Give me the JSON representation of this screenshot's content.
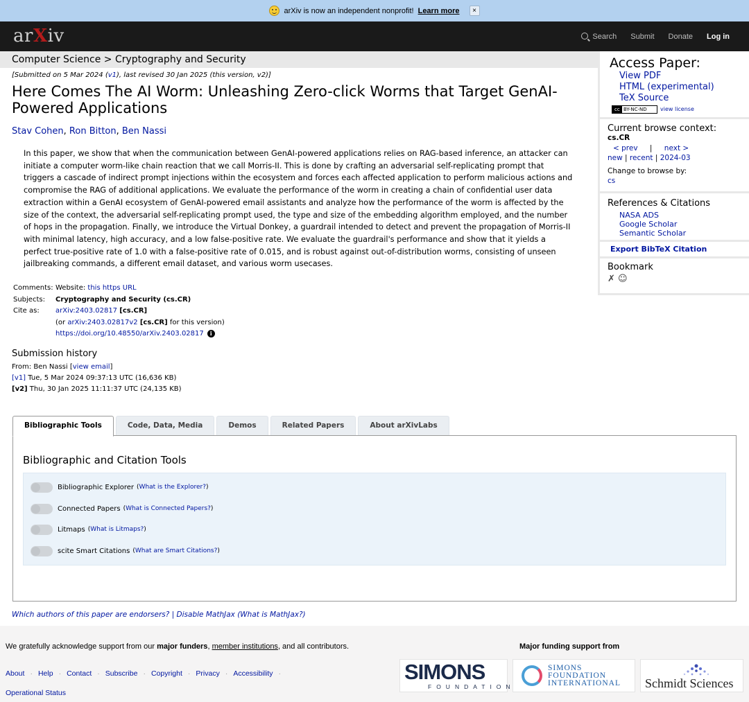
{
  "banner": {
    "message": "arXiv is now an independent nonprofit!",
    "link": "Learn more",
    "close": "×"
  },
  "header": {
    "logo_pre": "ar",
    "logo_x": "X",
    "logo_post": "iv",
    "nav": {
      "search": "Search",
      "submit": "Submit",
      "donate": "Donate",
      "login": "Log in"
    }
  },
  "breadcrumb": "Computer Science > Cryptography and Security",
  "paper": {
    "dateline_pre": "[Submitted on 5 Mar 2024 (",
    "dateline_v1": "v1",
    "dateline_post": "), last revised 30 Jan 2025 (this version, v2)]",
    "title": "Here Comes The AI Worm: Unleashing Zero-click Worms that Target GenAI-Powered Applications",
    "authors": [
      "Stav Cohen",
      "Ron Bitton",
      "Ben Nassi"
    ],
    "abstract": "In this paper, we show that when the communication between GenAI-powered applications relies on RAG-based inference, an attacker can initiate a computer worm-like chain reaction that we call Morris-II. This is done by crafting an adversarial self-replicating prompt that triggers a cascade of indirect prompt injections within the ecosystem and forces each affected application to perform malicious actions and compromise the RAG of additional applications. We evaluate the performance of the worm in creating a chain of confidential user data extraction within a GenAI ecosystem of GenAI-powered email assistants and analyze how the performance of the worm is affected by the size of the context, the adversarial self-replicating prompt used, the type and size of the embedding algorithm employed, and the number of hops in the propagation. Finally, we introduce the Virtual Donkey, a guardrail intended to detect and prevent the propagation of Morris-II with minimal latency, high accuracy, and a low false-positive rate. We evaluate the guardrail's performance and show that it yields a perfect true-positive rate of 1.0 with a false-positive rate of 0.015, and is robust against out-of-distribution worms, consisting of unseen jailbreaking commands, a different email dataset, and various worm usecases."
  },
  "meta": {
    "comments_label": "Comments:",
    "comments_text": "Website: ",
    "comments_link": "this https URL",
    "subjects_label": "Subjects:",
    "subjects_value": "Cryptography and Security (cs.CR)",
    "cite_label": "Cite as:",
    "cite_id": "arXiv:2403.02817",
    "cite_cat": "[cs.CR]",
    "cite_or_pre": "(or ",
    "cite_v2": "arXiv:2403.02817v2",
    "cite_v2_cat": "[cs.CR]",
    "cite_v2_post": " for this version)",
    "doi": "https://doi.org/10.48550/arXiv.2403.02817"
  },
  "history": {
    "heading": "Submission history",
    "from_pre": "From: Ben Nassi [",
    "from_link": "view email",
    "from_post": "]",
    "v1_tag": "[v1]",
    "v1_text": " Tue, 5 Mar 2024 09:37:13 UTC (16,636 KB)",
    "v2_tag": "[v2]",
    "v2_text": " Thu, 30 Jan 2025 11:11:37 UTC (24,135 KB)"
  },
  "sidebar": {
    "access_title": "Access Paper:",
    "access_links": [
      "View PDF",
      "HTML (experimental)",
      "TeX Source"
    ],
    "license_badge": "BY-NC-ND",
    "view_license": "view license",
    "browse_title": "Current browse context:",
    "browse_ctx": "cs.CR",
    "prev": "< prev",
    "sep": "|",
    "next": "next >",
    "new": "new",
    "recent": "recent",
    "month": "2024-03",
    "change_title": "Change to browse by:",
    "change_cs": "cs",
    "refs_title": "References & Citations",
    "refs_links": [
      "NASA ADS",
      "Google Scholar",
      "Semantic Scholar"
    ],
    "export": "Export BibTeX Citation",
    "bookmark_title": "Bookmark"
  },
  "tabs": [
    "Bibliographic Tools",
    "Code, Data, Media",
    "Demos",
    "Related Papers",
    "About arXivLabs"
  ],
  "tools": {
    "heading": "Bibliographic and Citation Tools",
    "items": [
      {
        "label": "Bibliographic Explorer",
        "q": "What is the Explorer?"
      },
      {
        "label": "Connected Papers",
        "q": "What is Connected Papers?"
      },
      {
        "label": "Litmaps",
        "q": "What is Litmaps?"
      },
      {
        "label": "scite Smart Citations",
        "q": "What are Smart Citations?"
      }
    ]
  },
  "endorse": {
    "endorsers": "Which authors of this paper are endorsers?",
    "sep": " | ",
    "mathjax": "Disable MathJax",
    "what": "(What is MathJax?)"
  },
  "footer": {
    "ack_pre": "We gratefully acknowledge support from our ",
    "ack_funders": "major funders",
    "ack_comma": ", ",
    "ack_members": "member institutions",
    "ack_post": ", and all contributors.",
    "links": [
      "About",
      "Help",
      "Contact",
      "Subscribe",
      "Copyright",
      "Privacy",
      "Accessibility",
      "Operational Status"
    ],
    "major_funding": "Major funding support from",
    "simons_big": "SIMONS",
    "simons_small": "FOUNDATION",
    "sfi_text": [
      "SIMONS",
      "FOUNDATION",
      "INTERNATIONAL"
    ],
    "schmidt": "Schmidt Sciences"
  }
}
